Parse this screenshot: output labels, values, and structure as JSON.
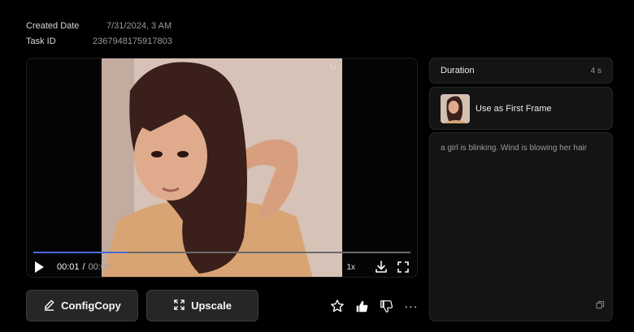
{
  "meta": {
    "created_label": "Created Date",
    "created_value": "7/31/2024, 3 AM",
    "task_label": "Task ID",
    "task_value": "2367948175917803"
  },
  "player": {
    "watermark": "Li",
    "current_time": "00:01",
    "separator": "/",
    "duration_time": "00:04",
    "speed": "1x",
    "progress": 0.25,
    "accent_color": "#4a6bdc",
    "icons": [
      "play-icon",
      "download-icon",
      "fullscreen-icon"
    ]
  },
  "buttons": {
    "config_label": "ConfigCopy",
    "upscale_label": "Upscale",
    "icons": [
      "pencil-icon",
      "expand-icon"
    ]
  },
  "actions": {
    "icons": [
      "star-icon",
      "thumbs-up-icon",
      "thumbs-down-icon",
      "more-icon"
    ],
    "more_glyph": "···"
  },
  "panel": {
    "duration_label": "Duration",
    "duration_value": "4 s",
    "first_frame_label": "Use as First Frame",
    "prompt_text": "a girl is blinking. Wind is blowing her hair",
    "icons": [
      "copy-icon"
    ]
  }
}
